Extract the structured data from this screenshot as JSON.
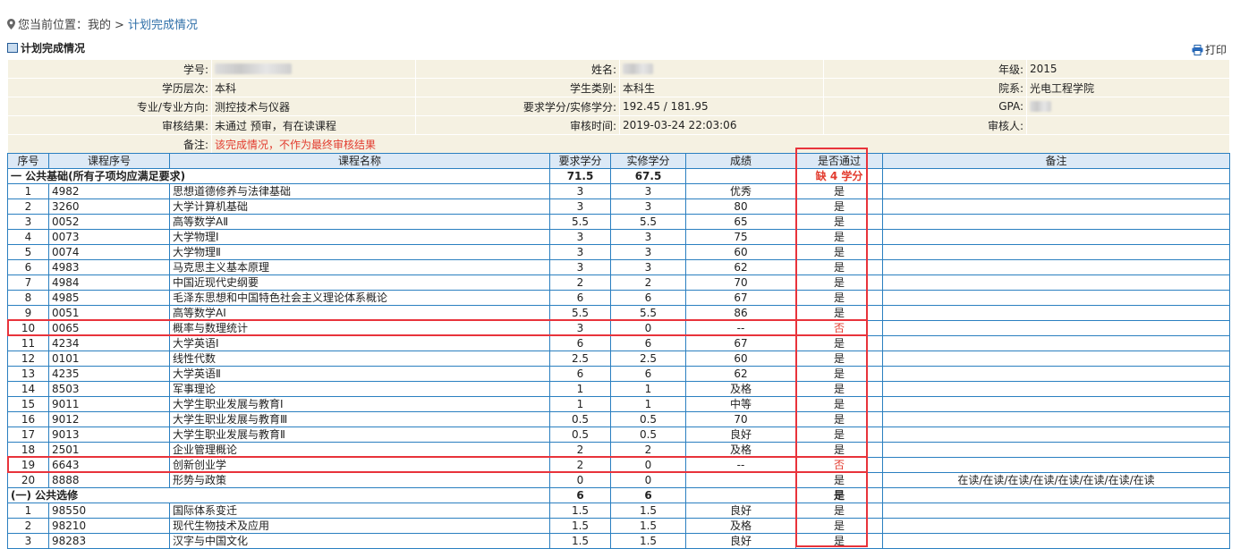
{
  "breadcrumb": {
    "prefix": "您当前位置：",
    "home": "我的",
    "separator": ">",
    "current": "计划完成情况"
  },
  "section_title": "计划完成情况",
  "print_label": "打印",
  "info": {
    "student_id_label": "学号:",
    "name_label": "姓名:",
    "grade_label": "年级:",
    "grade": "2015",
    "level_label": "学历层次:",
    "level": "本科",
    "student_type_label": "学生类别:",
    "student_type": "本科生",
    "dept_label": "院系:",
    "dept": "光电工程学院",
    "major_label": "专业/专业方向:",
    "major": "测控技术与仪器",
    "credits_label": "要求学分/实修学分:",
    "credits": "192.45 / 181.95",
    "gpa_label": "GPA:",
    "audit_result_label": "审核结果:",
    "audit_result": "未通过 预审，有在读课程",
    "audit_time_label": "审核时间:",
    "audit_time": "2019-03-24 22:03:06",
    "auditor_label": "审核人:",
    "remark_label": "备注:",
    "remark": "该完成情况，不作为最终审核结果"
  },
  "columns": [
    "序号",
    "课程序号",
    "课程名称",
    "要求学分",
    "实修学分",
    "成绩",
    "是否通过",
    "备注"
  ],
  "groups": [
    {
      "title": "一 公共基础(所有子项均应满足要求)",
      "required": "71.5",
      "earned": "67.5",
      "passed": "缺 4 学分",
      "passed_red": true,
      "rows": [
        [
          "1",
          "4982",
          "思想道德修养与法律基础",
          "3",
          "3",
          "优秀",
          "是",
          ""
        ],
        [
          "2",
          "3260",
          "大学计算机基础",
          "3",
          "3",
          "80",
          "是",
          ""
        ],
        [
          "3",
          "0052",
          "高等数学AⅡ",
          "5.5",
          "5.5",
          "65",
          "是",
          ""
        ],
        [
          "4",
          "0073",
          "大学物理Ⅰ",
          "3",
          "3",
          "75",
          "是",
          ""
        ],
        [
          "5",
          "0074",
          "大学物理Ⅱ",
          "3",
          "3",
          "60",
          "是",
          ""
        ],
        [
          "6",
          "4983",
          "马克思主义基本原理",
          "3",
          "3",
          "62",
          "是",
          ""
        ],
        [
          "7",
          "4984",
          "中国近现代史纲要",
          "2",
          "2",
          "70",
          "是",
          ""
        ],
        [
          "8",
          "4985",
          "毛泽东思想和中国特色社会主义理论体系概论",
          "6",
          "6",
          "67",
          "是",
          ""
        ],
        [
          "9",
          "0051",
          "高等数学AⅠ",
          "5.5",
          "5.5",
          "86",
          "是",
          ""
        ],
        [
          "10",
          "0065",
          "概率与数理统计",
          "3",
          "0",
          "--",
          "否",
          ""
        ],
        [
          "11",
          "4234",
          "大学英语Ⅰ",
          "6",
          "6",
          "67",
          "是",
          ""
        ],
        [
          "12",
          "0101",
          "线性代数",
          "2.5",
          "2.5",
          "60",
          "是",
          ""
        ],
        [
          "13",
          "4235",
          "大学英语Ⅱ",
          "6",
          "6",
          "62",
          "是",
          ""
        ],
        [
          "14",
          "8503",
          "军事理论",
          "1",
          "1",
          "及格",
          "是",
          ""
        ],
        [
          "15",
          "9011",
          "大学生职业发展与教育Ⅰ",
          "1",
          "1",
          "中等",
          "是",
          ""
        ],
        [
          "16",
          "9012",
          "大学生职业发展与教育Ⅲ",
          "0.5",
          "0.5",
          "70",
          "是",
          ""
        ],
        [
          "17",
          "9013",
          "大学生职业发展与教育Ⅱ",
          "0.5",
          "0.5",
          "良好",
          "是",
          ""
        ],
        [
          "18",
          "2501",
          "企业管理概论",
          "2",
          "2",
          "及格",
          "是",
          ""
        ],
        [
          "19",
          "6643",
          "创新创业学",
          "2",
          "0",
          "--",
          "否",
          ""
        ],
        [
          "20",
          "8888",
          "形势与政策",
          "0",
          "0",
          "",
          "是",
          "在读/在读/在读/在读/在读/在读/在读/在读"
        ]
      ]
    },
    {
      "title": "(一) 公共选修",
      "required": "6",
      "earned": "6",
      "passed": "是",
      "passed_red": false,
      "rows": [
        [
          "1",
          "98550",
          "国际体系变迁",
          "1.5",
          "1.5",
          "良好",
          "是",
          ""
        ],
        [
          "2",
          "98210",
          "现代生物技术及应用",
          "1.5",
          "1.5",
          "及格",
          "是",
          ""
        ],
        [
          "3",
          "98283",
          "汉字与中国文化",
          "1.5",
          "1.5",
          "良好",
          "是",
          ""
        ]
      ]
    }
  ],
  "colors": {
    "accent": "#2a7fc0",
    "highlight": "#e8333b",
    "fail_text": "#e23b2e",
    "info_bg": "#f5f1e2",
    "header_bg": "#dce9f6"
  },
  "icons": [
    "location-pin-icon",
    "table-icon",
    "printer-icon"
  ]
}
